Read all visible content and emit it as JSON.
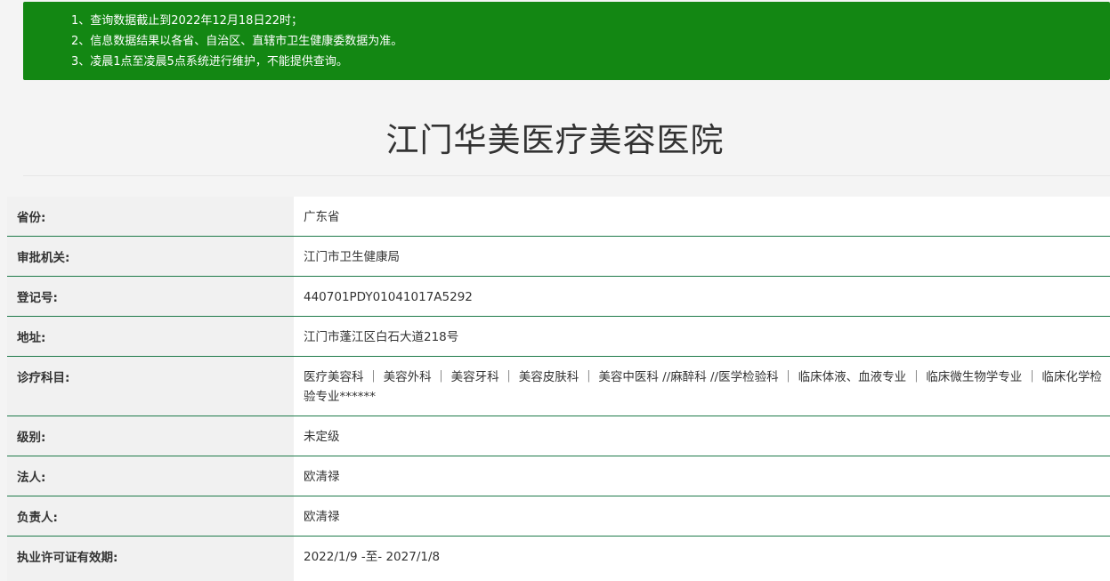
{
  "notice": {
    "lines": [
      "1、查询数据截止到2022年12月18日22时；",
      "2、信息数据结果以各省、自治区、直辖市卫生健康委数据为准。",
      "3、凌晨1点至凌晨5点系统进行维护，不能提供查询。"
    ]
  },
  "hospital": {
    "name": "江门华美医疗美容医院"
  },
  "fields": [
    {
      "label": "省份:",
      "value": "广东省"
    },
    {
      "label": "审批机关:",
      "value": "江门市卫生健康局"
    },
    {
      "label": "登记号:",
      "value": "440701PDY01041017A5292"
    },
    {
      "label": "地址:",
      "value": "江门市蓬江区白石大道218号"
    },
    {
      "label": "诊疗科目:",
      "value": "医疗美容科 ｜ 美容外科 ｜ 美容牙科 ｜ 美容皮肤科 ｜ 美容中医科 //麻醉科 //医学检验科 ｜ 临床体液、血液专业 ｜ 临床微生物学专业 ｜ 临床化学检验专业******"
    },
    {
      "label": "级别:",
      "value": "未定级"
    },
    {
      "label": "法人:",
      "value": "欧清禄"
    },
    {
      "label": "负责人:",
      "value": "欧清禄"
    },
    {
      "label": "执业许可证有效期:",
      "value": "2022/1/9 -至- 2027/1/8"
    }
  ]
}
